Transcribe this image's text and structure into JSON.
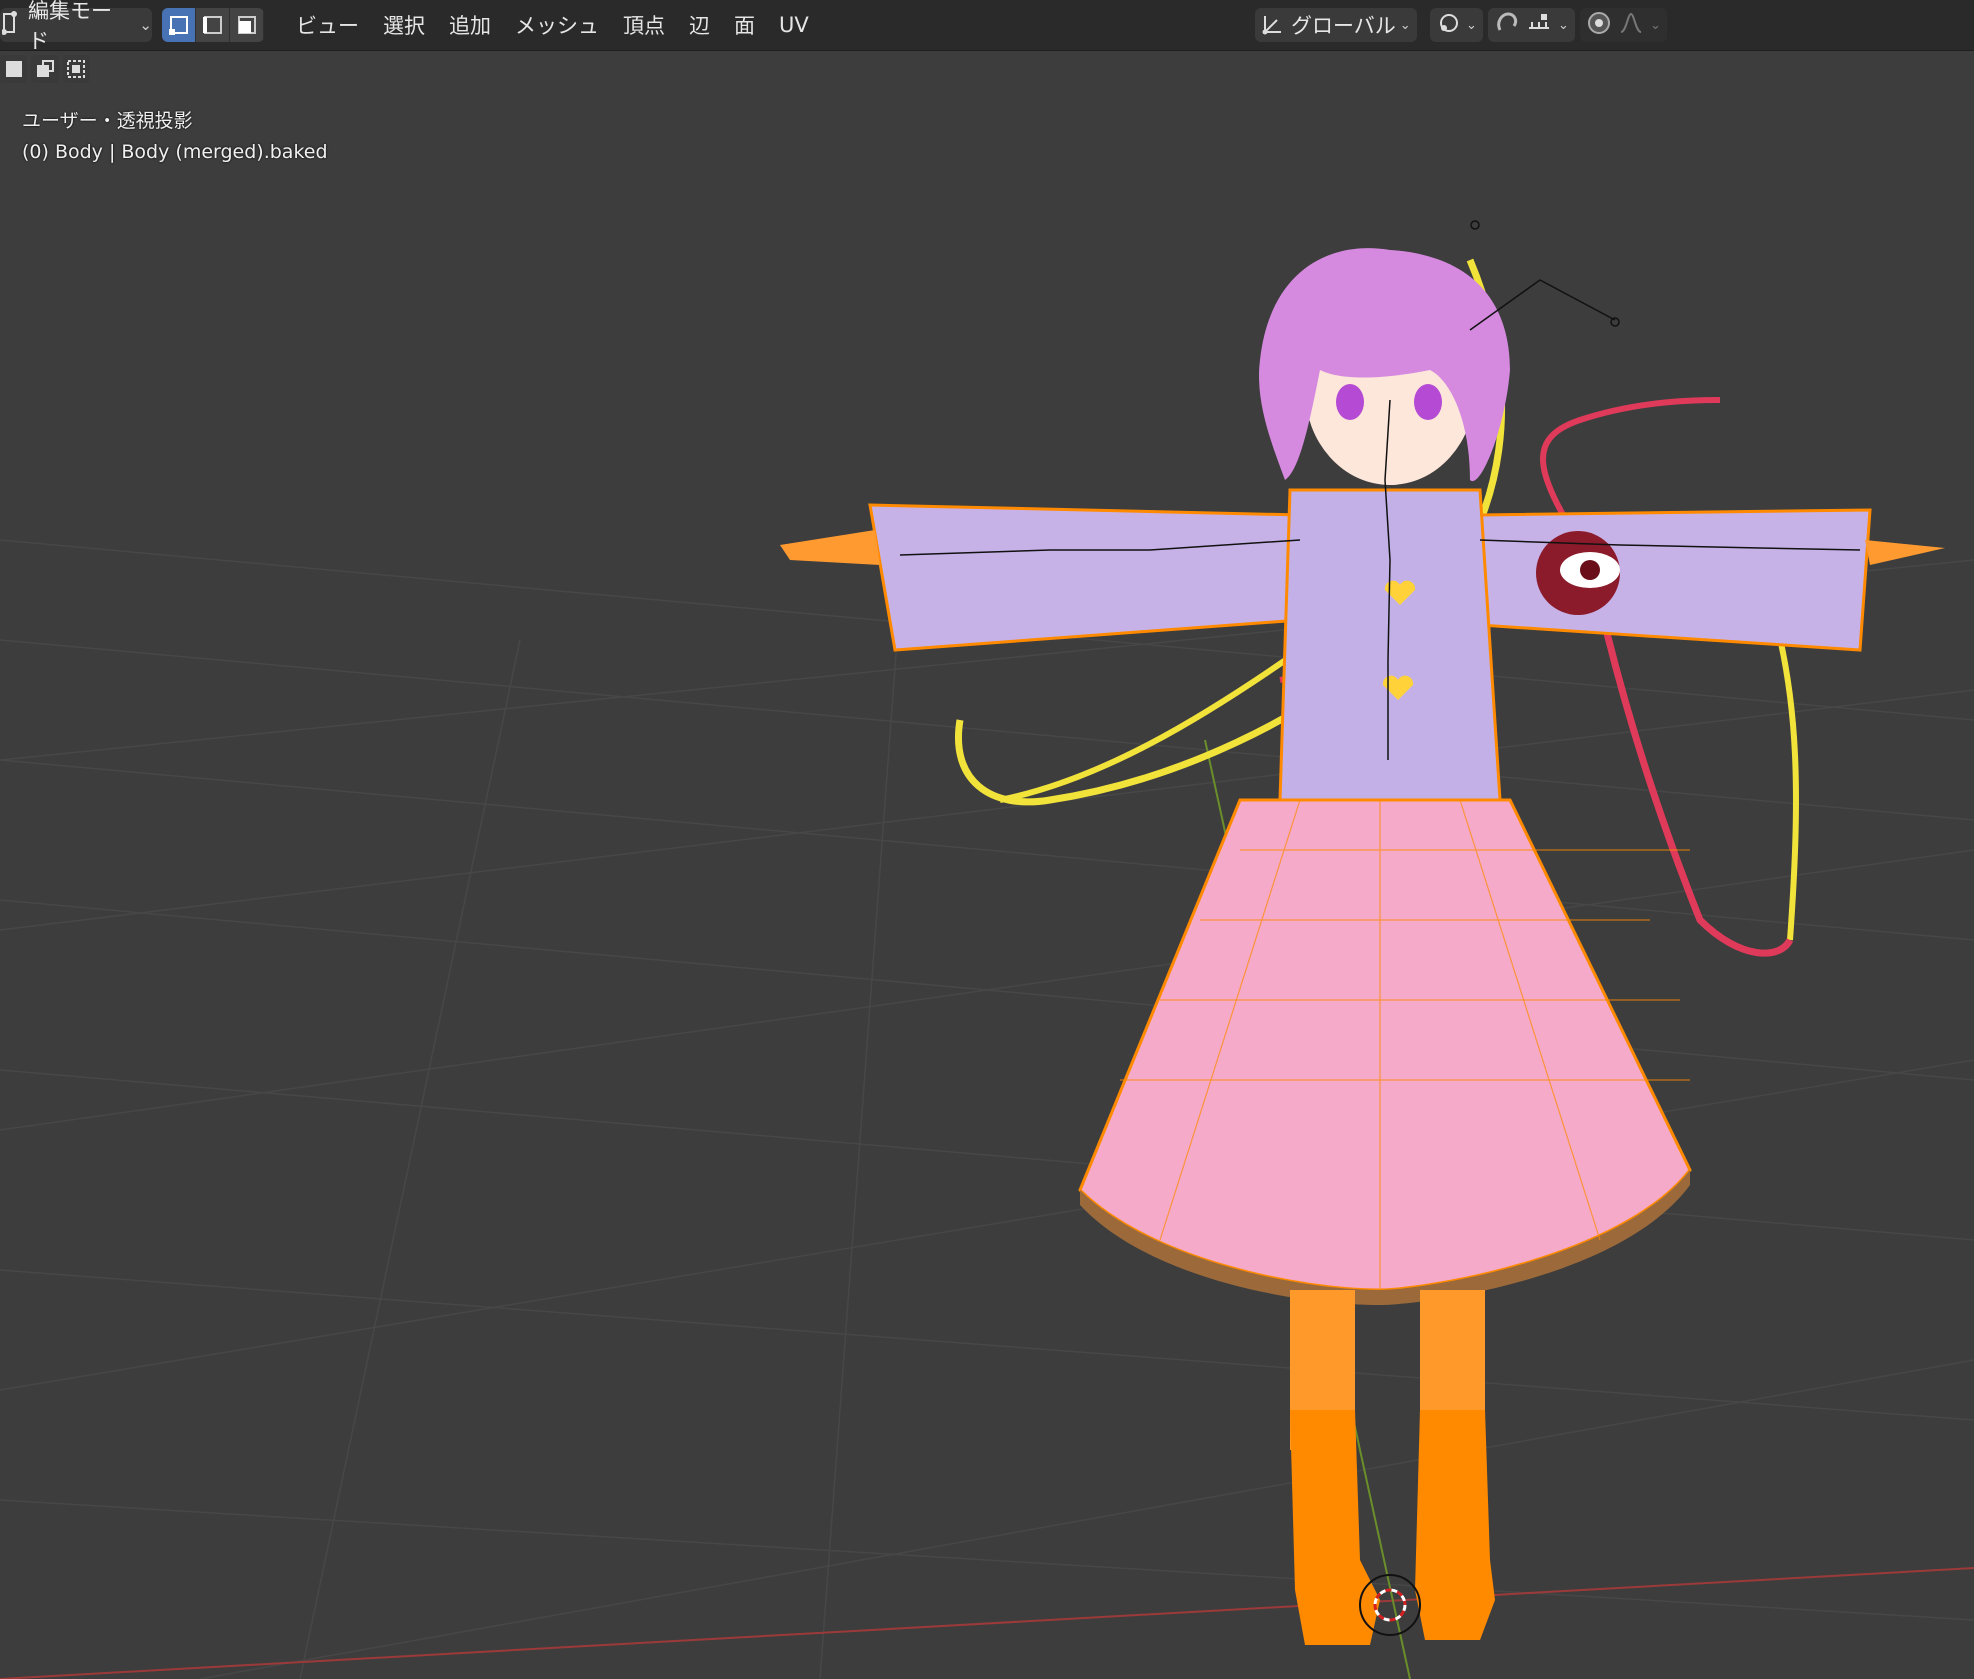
{
  "header": {
    "mode_label": "編集モード",
    "menu": [
      "ビュー",
      "選択",
      "追加",
      "メッシュ",
      "頂点",
      "辺",
      "面",
      "UV"
    ],
    "orientation_label": "グローバル",
    "icons": [
      "edit-mode-icon",
      "vertex-select-icon",
      "edge-select-icon",
      "face-select-icon",
      "transform-orientation-icon",
      "pivot-icon",
      "snap-icon",
      "snap-increment-icon",
      "proportional-edit-icon",
      "falloff-icon"
    ]
  },
  "viewport": {
    "view_label": "ユーザー・透視投影",
    "object_label": "(0) Body | Body (merged).baked"
  },
  "colors": {
    "background": "#3d3d3d",
    "grid": "#4a4a4a",
    "header": "#2a2a2a",
    "active_select": "#4772b3",
    "mesh_orange": "#ff8a00",
    "x_axis": "#9c3a3a",
    "y_axis": "#6a8f2a"
  }
}
